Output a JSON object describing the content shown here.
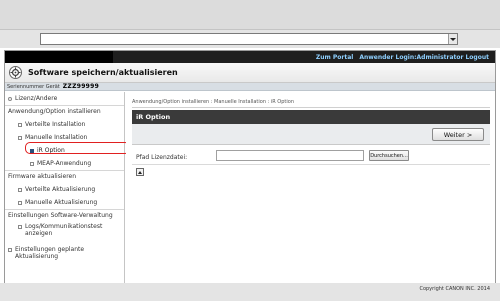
{
  "header": {
    "portal_link": "Zum Portal",
    "login_text": "Anwender Login:Administrator",
    "logout_link": "Logout"
  },
  "title": "Software speichern/aktualisieren",
  "serial": {
    "label": "Seriennummer Gerät",
    "value": "ZZZ99999"
  },
  "sidebar": {
    "license": "Lizenz/Andere",
    "install_section": "Anwendung/Option installieren",
    "distributed_install": "Verteilte Installation",
    "manual_install": "Manuelle Installation",
    "ir_option": "iR Option",
    "meap_app": "MEAP-Anwendung",
    "firmware_section": "Firmware aktualisieren",
    "distributed_update": "Verteilte Aktualisierung",
    "manual_update": "Manuelle Aktualisierung",
    "settings_section": "Einstellungen Software-Verwaltung",
    "logs": "Logs/Kommunikationstest anzeigen",
    "scheduled": "Einstellungen geplante Aktualisierung"
  },
  "main": {
    "breadcrumb": "Anwendung/Option installieren : Manuelle Installation : iR Option",
    "panel_title": "iR Option",
    "next_button": "Weiter >",
    "path_label": "Pfad Lizenzdatei:",
    "browse_button": "Durchsuchen..."
  },
  "footer": "Copyright CANON INC. 2014",
  "colors": {
    "highlight": "#e02020",
    "header_link": "#8fd0ff",
    "panel": "#3a3a3a"
  }
}
